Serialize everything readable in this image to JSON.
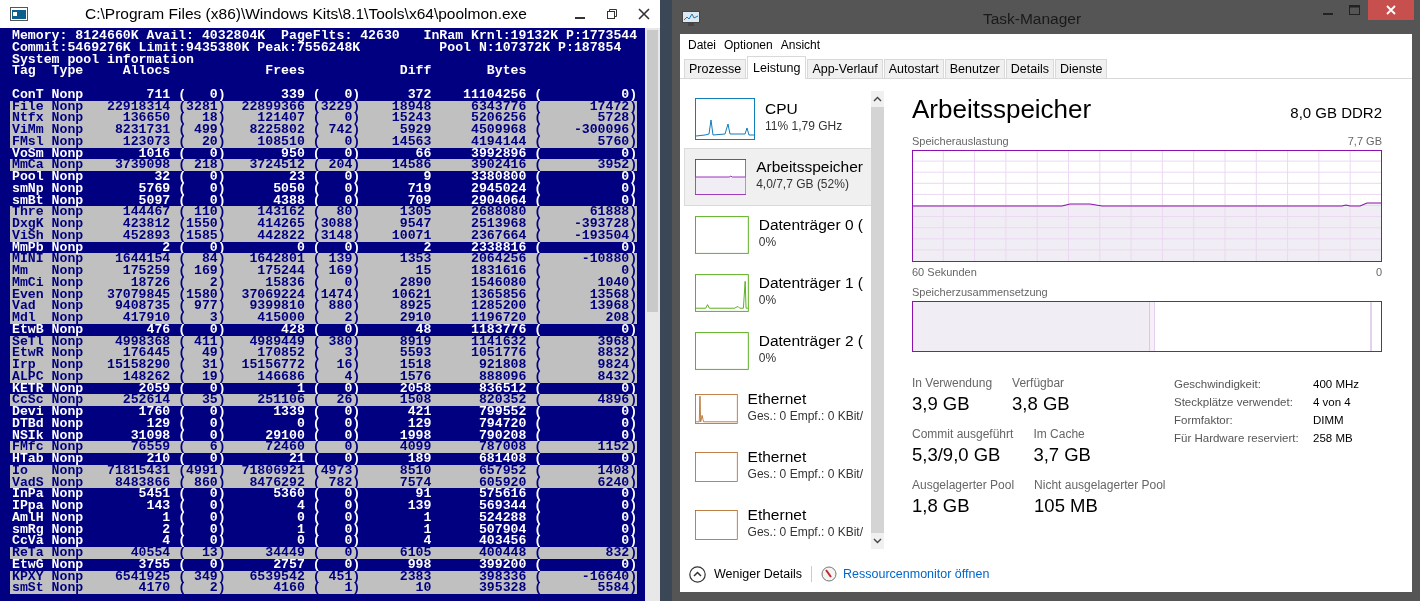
{
  "console_window": {
    "title": "C:\\Program Files (x86)\\Windows Kits\\8.1\\Tools\\x64\\poolmon.exe",
    "summary_lines": [
      "Memory: 8124660K Avail: 4032804K  PageFlts: 42630   InRam Krnl:19132K P:1773544",
      "Commit:5469276K Limit:9435380K Peak:7556248K          Pool N:107372K P:187854",
      "System pool information"
    ],
    "column_header": "Tag  Type     Allocs            Frees            Diff       Bytes",
    "rows": [
      {
        "text": "ConT Nonp        711 (   0)       339 (   0)      372    11104256 (          0)",
        "highlighted": false
      },
      {
        "text": "File Nonp   22918314 (3281)  22899366 (3229)    18948     6343776 (      17472)",
        "highlighted": true
      },
      {
        "text": "Ntfx Nonp     136650 (  18)    121407 (   0)    15243     5206256 (       5728)",
        "highlighted": true
      },
      {
        "text": "ViMm Nonp    8231731 ( 499)   8225802 ( 742)     5929     4509968 (    -300096)",
        "highlighted": true
      },
      {
        "text": "FMsl Nonp     123073 (  20)    108510 (   0)    14563     4194144 (       5760)",
        "highlighted": true
      },
      {
        "text": "VoSm Nonp       1016 (   0)       950 (   0)       66     3992896 (          0)",
        "highlighted": false
      },
      {
        "text": "MmCa Nonp    3739098 ( 218)   3724512 ( 204)    14586     3902416 (       3952)",
        "highlighted": true
      },
      {
        "text": "Pool Nonp         32 (   0)        23 (   0)        9     3380800 (          0)",
        "highlighted": false
      },
      {
        "text": "smNp Nonp       5769 (   0)      5050 (   0)      719     2945024 (          0)",
        "highlighted": false
      },
      {
        "text": "smBt Nonp       5097 (   0)      4388 (   0)      709     2904064 (          0)",
        "highlighted": false
      },
      {
        "text": "Thre Nonp     144467 ( 110)    143162 (  80)     1305     2688080 (      61888)",
        "highlighted": true
      },
      {
        "text": "DxgK Nonp     423812 (1550)    414265 (3088)     9547     2513968 (    -393728)",
        "highlighted": true
      },
      {
        "text": "ViSh Nonp     452893 (1585)    442822 (3148)    10071     2367664 (    -193504)",
        "highlighted": true
      },
      {
        "text": "MmPb Nonp          2 (   0)         0 (   0)        2     2338816 (          0)",
        "highlighted": false
      },
      {
        "text": "MINI Nonp    1644154 (  84)   1642801 ( 139)     1353     2064256 (     -10880)",
        "highlighted": true
      },
      {
        "text": "Mm   Nonp     175259 ( 169)    175244 ( 169)       15     1831616 (          0)",
        "highlighted": true
      },
      {
        "text": "MmCi Nonp      18726 (   2)     15836 (   0)     2890     1546080 (       1040)",
        "highlighted": true
      },
      {
        "text": "Even Nonp   37079845 (1580)  37069224 (1474)    10621     1365856 (      13568)",
        "highlighted": true
      },
      {
        "text": "Vad  Nonp    9408735 ( 977)   9399810 ( 880)     8925     1285200 (      13968)",
        "highlighted": true
      },
      {
        "text": "Mdl  Nonp     417910 (   3)    415000 (   2)     2910     1196720 (        208)",
        "highlighted": true
      },
      {
        "text": "EtwB Nonp        476 (   0)       428 (   0)       48     1183776 (          0)",
        "highlighted": false
      },
      {
        "text": "SeTl Nonp    4998368 ( 411)   4989449 ( 380)     8919     1141632 (       3968)",
        "highlighted": true
      },
      {
        "text": "EtwR Nonp     176445 (  49)    170852 (   3)     5593     1051776 (       8832)",
        "highlighted": true
      },
      {
        "text": "Irp  Nonp   15158290 (  31)  15156772 (  16)     1518      921808 (       9824)",
        "highlighted": true
      },
      {
        "text": "ALPC Nonp     148262 (  19)    146686 (   4)     1576      888096 (       8432)",
        "highlighted": true
      },
      {
        "text": "KETR Nonp       2059 (   0)         1 (   0)     2058      836512 (          0)",
        "highlighted": false
      },
      {
        "text": "CcSc Nonp     252614 (  35)    251106 (  26)     1508      820352 (       4896)",
        "highlighted": true
      },
      {
        "text": "Devi Nonp       1760 (   0)      1339 (   0)      421      799552 (          0)",
        "highlighted": false
      },
      {
        "text": "DTBd Nonp        129 (   0)         0 (   0)      129      794720 (          0)",
        "highlighted": false
      },
      {
        "text": "NSIk Nonp      31098 (   0)     29100 (   0)     1998      790208 (          0)",
        "highlighted": false
      },
      {
        "text": "FMfc Nonp      76559 (   6)     72460 (   0)     4099      787008 (       1152)",
        "highlighted": true
      },
      {
        "text": "HTab Nonp        210 (   0)        21 (   0)      189      681408 (          0)",
        "highlighted": false
      },
      {
        "text": "Io   Nonp   71815431 (4991)  71806921 (4973)     8510      657952 (       1408)",
        "highlighted": true
      },
      {
        "text": "VadS Nonp    8483866 ( 860)   8476292 ( 782)     7574      605920 (       6240)",
        "highlighted": true
      },
      {
        "text": "InPa Nonp       5451 (   0)      5360 (   0)       91      575616 (          0)",
        "highlighted": false
      },
      {
        "text": "IPpa Nonp        143 (   0)         4 (   0)      139      569344 (          0)",
        "highlighted": false
      },
      {
        "text": "AmlH Nonp          1 (   0)         0 (   0)        1      524288 (          0)",
        "highlighted": false
      },
      {
        "text": "smRg Nonp          2 (   0)         1 (   0)        1      507904 (          0)",
        "highlighted": false
      },
      {
        "text": "CcVa Nonp          4 (   0)         0 (   0)        4      403456 (          0)",
        "highlighted": false
      },
      {
        "text": "ReTa Nonp      40554 (  13)     34449 (   0)     6105      400448 (        832)",
        "highlighted": true
      },
      {
        "text": "EtwG Nonp       3755 (   0)      2757 (   0)      998      399200 (          0)",
        "highlighted": false
      },
      {
        "text": "KPXY Nonp    6541925 ( 349)   6539542 ( 451)     2383      398336 (     -16640)",
        "highlighted": true
      },
      {
        "text": "smSt Nonp       4170 (   2)      4160 (   1)       10      395328 (       5584)",
        "highlighted": true
      }
    ]
  },
  "task_manager": {
    "title": "Task-Manager",
    "menu": [
      "Datei",
      "Optionen",
      "Ansicht"
    ],
    "tabs": [
      {
        "label": "Prozesse",
        "selected": false
      },
      {
        "label": "Leistung",
        "selected": true
      },
      {
        "label": "App-Verlauf",
        "selected": false
      },
      {
        "label": "Autostart",
        "selected": false
      },
      {
        "label": "Benutzer",
        "selected": false
      },
      {
        "label": "Details",
        "selected": false
      },
      {
        "label": "Dienste",
        "selected": false
      }
    ],
    "sidebar_items": [
      {
        "kind": "cpu",
        "title": "CPU",
        "subtitle": "11%  1,79 GHz",
        "selected": false
      },
      {
        "kind": "memory",
        "title": "Arbeitsspeicher",
        "subtitle": "4,0/7,7 GB (52%)",
        "selected": true
      },
      {
        "kind": "disk",
        "title": "Datenträger 0 (",
        "subtitle": "0%",
        "selected": false
      },
      {
        "kind": "disk",
        "title": "Datenträger 1 (",
        "subtitle": "0%",
        "selected": false
      },
      {
        "kind": "disk",
        "title": "Datenträger 2 (",
        "subtitle": "0%",
        "selected": false
      },
      {
        "kind": "ethernet",
        "title": "Ethernet",
        "subtitle": "Ges.: 0 Empf.: 0 KBit/",
        "selected": false
      },
      {
        "kind": "ethernet",
        "title": "Ethernet",
        "subtitle": "Ges.: 0 Empf.: 0 KBit/",
        "selected": false
      },
      {
        "kind": "ethernet",
        "title": "Ethernet",
        "subtitle": "Ges.: 0 Empf.: 0 KBit/",
        "selected": false
      }
    ],
    "panel": {
      "title": "Arbeitsspeicher",
      "spec": "8,0 GB DDR2",
      "usage_label": "Speicherauslastung",
      "usage_max": "7,7 GB",
      "time_span": "60 Sekunden",
      "time_end": "0",
      "composition_label": "Speicherzusammensetzung",
      "stats": [
        [
          {
            "label": "In Verwendung",
            "value": "3,9 GB"
          },
          {
            "label": "Verfügbar",
            "value": "3,8 GB"
          }
        ],
        [
          {
            "label": "Commit ausgeführt",
            "value": "5,3/9,0 GB"
          },
          {
            "label": "Im Cache",
            "value": "3,7 GB"
          }
        ],
        [
          {
            "label": "Ausgelagerter Pool",
            "value": "1,8 GB"
          },
          {
            "label": "Nicht ausgelagerter Pool",
            "value": "105 MB"
          }
        ]
      ],
      "details": [
        {
          "label": "Geschwindigkeit:",
          "value": "400 MHz"
        },
        {
          "label": "Steckplätze verwendet:",
          "value": "4 von 4"
        },
        {
          "label": "Formfaktor:",
          "value": "DIMM"
        },
        {
          "label": "Für Hardware reserviert:",
          "value": "258 MB"
        }
      ]
    },
    "footer": {
      "toggle": "Weniger Details",
      "link": "Ressourcenmonitor öffnen"
    }
  }
}
